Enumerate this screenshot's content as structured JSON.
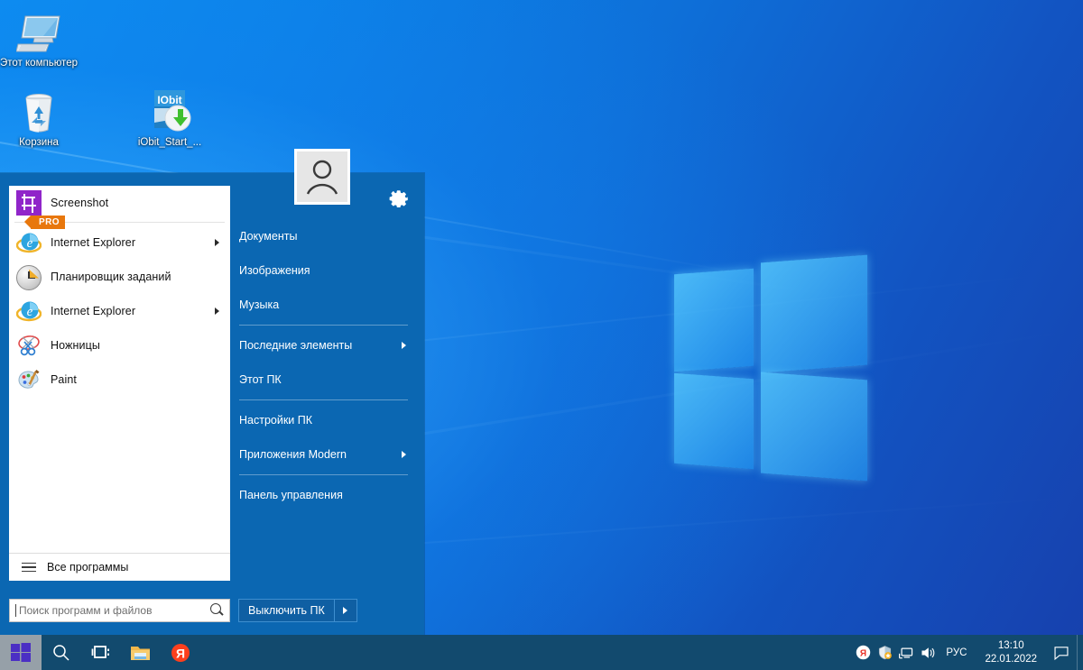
{
  "desktop": {
    "icons": [
      {
        "name": "this-computer",
        "label": "Этот компьютер",
        "icon": "computer-icon"
      },
      {
        "name": "recycle-bin",
        "label": "Корзина",
        "icon": "recycle-bin-icon"
      },
      {
        "name": "iobit-start-menu",
        "label": "iObit_Start_...",
        "icon": "iobit-installer-icon"
      }
    ]
  },
  "start_menu": {
    "avatar": {
      "badge": "PRO",
      "icon": "user-avatar-icon"
    },
    "settings_icon": "gear-icon",
    "programs": [
      {
        "label": "Screenshot",
        "icon": "screenshot-crop-icon",
        "has_submenu": false,
        "pinned": true
      },
      {
        "label": "Internet Explorer",
        "icon": "internet-explorer-icon",
        "has_submenu": true
      },
      {
        "label": "Планировщик заданий",
        "icon": "task-scheduler-clock-icon",
        "has_submenu": false
      },
      {
        "label": "Internet Explorer",
        "icon": "internet-explorer-icon",
        "has_submenu": true
      },
      {
        "label": "Ножницы",
        "icon": "snipping-tool-scissors-icon",
        "has_submenu": false
      },
      {
        "label": "Paint",
        "icon": "paint-palette-icon",
        "has_submenu": false
      }
    ],
    "all_programs": {
      "label": "Все программы",
      "icon": "hamburger-icon"
    },
    "search": {
      "placeholder": "Поиск программ и файлов",
      "value": "",
      "icon": "search-icon"
    },
    "shutdown": {
      "label": "Выключить ПК",
      "chevron_icon": "chevron-right-icon"
    },
    "right_items": [
      {
        "label": "Документы",
        "has_submenu": false
      },
      {
        "label": "Изображения",
        "has_submenu": false
      },
      {
        "label": "Музыка",
        "has_submenu": false
      },
      {
        "separator": true
      },
      {
        "label": "Последние элементы",
        "has_submenu": true
      },
      {
        "label": "Этот ПК",
        "has_submenu": false
      },
      {
        "separator": true
      },
      {
        "label": "Настройки ПК",
        "has_submenu": false
      },
      {
        "label": "Приложения Modern",
        "has_submenu": true
      },
      {
        "separator": true
      },
      {
        "label": "Панель управления",
        "has_submenu": false
      }
    ]
  },
  "taskbar": {
    "start_button": {
      "name": "start-button",
      "icon": "windows-logo-icon"
    },
    "buttons": [
      {
        "name": "search-taskbar-button",
        "icon": "search-icon"
      },
      {
        "name": "task-view-button",
        "icon": "task-view-icon"
      },
      {
        "name": "file-explorer-button",
        "icon": "folder-icon"
      },
      {
        "name": "yandex-browser-button",
        "icon": "yandex-icon"
      }
    ],
    "tray": {
      "icons": [
        {
          "name": "tray-yandex",
          "icon": "yandex-icon"
        },
        {
          "name": "tray-iobit",
          "icon": "iobit-shield-icon"
        },
        {
          "name": "tray-network",
          "icon": "network-icon"
        },
        {
          "name": "tray-volume",
          "icon": "speaker-icon"
        }
      ],
      "language": "РУС",
      "time": "13:10",
      "date": "22.01.2022",
      "action_center": {
        "name": "action-center-button",
        "icon": "speech-bubble-icon"
      }
    }
  },
  "colors": {
    "start_menu_blue": "#0b67b2",
    "taskbar": "#124a6e",
    "accent_orange": "#e8770c",
    "screenshot_purple": "#9025c9",
    "wallpaper_blue": "#0b82e8"
  }
}
